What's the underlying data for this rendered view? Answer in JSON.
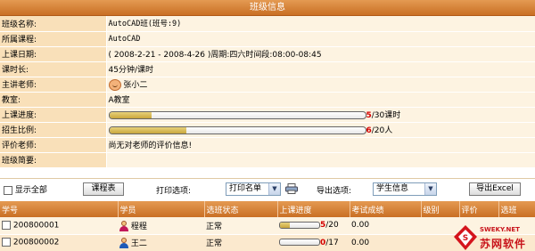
{
  "title": "班级信息",
  "info_rows": {
    "class_name": {
      "label": "班级名称:",
      "value": "AutoCAD班(班号:9)"
    },
    "course": {
      "label": "所属课程:",
      "value": "AutoCAD"
    },
    "dates": {
      "label": "上课日期:",
      "value": "( 2008-2-21 - 2008-4-26 )周期:四六时间段:08:00-08:45"
    },
    "duration": {
      "label": "课时长:",
      "value": "45分钟/课时"
    },
    "teacher": {
      "label": "主讲老师:",
      "value": "张小二"
    },
    "classroom": {
      "label": "教室:",
      "value": "A教室"
    },
    "progress": {
      "label": "上课进度:",
      "done": "5",
      "total": "/30课时",
      "fraction": 0.1667
    },
    "enroll": {
      "label": "招生比例:",
      "done": "6",
      "total": "/20人",
      "fraction": 0.3
    },
    "review": {
      "label": "评价老师:",
      "value": "尚无对老师的评价信息!"
    },
    "brief": {
      "label": "班级简要:",
      "value": ""
    }
  },
  "toolbar": {
    "show_all": "显示全部",
    "schedule_btn": "课程表",
    "print_label": "打印选项:",
    "print_select": "打印名单",
    "export_label": "导出选项:",
    "export_select": "学生信息",
    "export_btn": "导出Excel"
  },
  "grid": {
    "headers": [
      "学号",
      "学员",
      "选班状态",
      "上课进度",
      "考试成绩",
      "级别",
      "评价",
      "选班"
    ],
    "rows": [
      {
        "id": "200800001",
        "name": "程程",
        "status": "正常",
        "done": "5",
        "total": "/20",
        "fraction": 0.25,
        "score": "0.00",
        "gender_color": "#c2185b"
      },
      {
        "id": "200800002",
        "name": "王二",
        "status": "正常",
        "done": "0",
        "total": "/17",
        "fraction": 0,
        "score": "0.00",
        "gender_color": "#1e5bb8"
      }
    ]
  },
  "watermark": {
    "url": "SWEKY.NET",
    "text": "苏网软件"
  },
  "colors": {
    "header": "#d9843c",
    "label_bg": "#f9e0b9",
    "value_bg": "#fdf3e1",
    "accent_red": "#d40000"
  }
}
